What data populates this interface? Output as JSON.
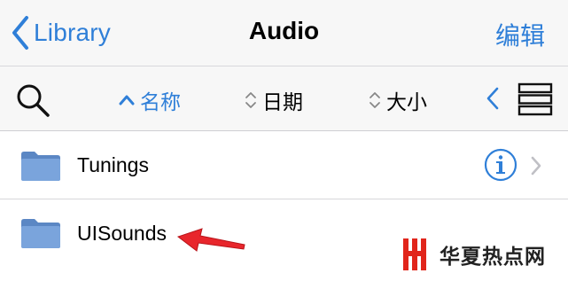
{
  "navbar": {
    "back_label": "Library",
    "title": "Audio",
    "edit_label": "编辑"
  },
  "toolbar": {
    "sort_options": [
      {
        "label": "名称",
        "active": true,
        "indicator": "chevron-up-icon"
      },
      {
        "label": "日期",
        "active": false,
        "indicator": "sort-updown-icon"
      },
      {
        "label": "大小",
        "active": false,
        "indicator": "sort-updown-icon"
      }
    ]
  },
  "folders": [
    {
      "name": "Tunings",
      "has_info": true,
      "has_disclosure": true
    },
    {
      "name": "UISounds",
      "has_info": false,
      "has_disclosure": false
    }
  ],
  "watermark": {
    "text": "华夏热点网"
  },
  "colors": {
    "accent": "#2f7fd8",
    "bar_bg": "#f7f7f7",
    "folder": "#6f9ad3",
    "arrow": "#e8262c",
    "watermark_red": "#e1251b"
  }
}
